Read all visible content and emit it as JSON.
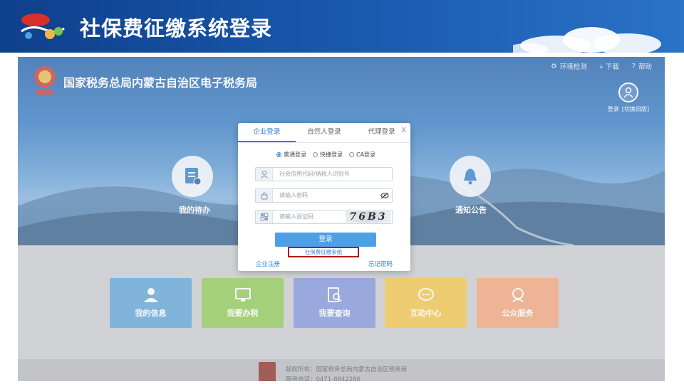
{
  "slide": {
    "title": "社保费征缴系统登录"
  },
  "portal": {
    "title": "国家税务总局内蒙古自治区电子税务局",
    "topnav": [
      {
        "label": "环境检测",
        "icon": "wrench-icon"
      },
      {
        "label": "下载",
        "icon": "download-icon"
      },
      {
        "label": "帮助",
        "icon": "help-icon"
      }
    ],
    "user": {
      "login": "登录",
      "switch": "[切换旧版]"
    },
    "shortcuts": [
      {
        "label": "我的待办",
        "icon": "todo-icon"
      },
      {
        "label": "通知公告",
        "icon": "bell-icon"
      }
    ],
    "tiles": [
      {
        "label": "我的信息",
        "color": "#5aa3d6",
        "icon": "person-icon"
      },
      {
        "label": "我要办税",
        "color": "#8ec94f",
        "icon": "monitor-icon"
      },
      {
        "label": "我要查询",
        "color": "#7d93d8",
        "icon": "search-doc-icon"
      },
      {
        "label": "互动中心",
        "color": "#f2c445",
        "icon": "chat-icon"
      },
      {
        "label": "公众服务",
        "color": "#f3a276",
        "icon": "service-icon"
      }
    ],
    "footer": {
      "line1": "版权所有：国家税务总局内蒙古自治区税务局",
      "line2": "服务电话：0471-8842266"
    }
  },
  "login_dialog": {
    "tabs": [
      "企业登录",
      "自然人登录",
      "代理登录"
    ],
    "active_tab": 0,
    "close": "X",
    "modes": [
      "普通登录",
      "快捷登录",
      "CA登录"
    ],
    "selected_mode": 0,
    "fields": {
      "id_placeholder": "社会信用代码/纳税人识别号",
      "password_placeholder": "请输入密码",
      "captcha_placeholder": "请输入验证码",
      "captcha_text": "76B3"
    },
    "login_button": "登录",
    "sb_system_link": "社保费征缴系统",
    "register": "企业注册",
    "forgot": "忘记密码"
  }
}
